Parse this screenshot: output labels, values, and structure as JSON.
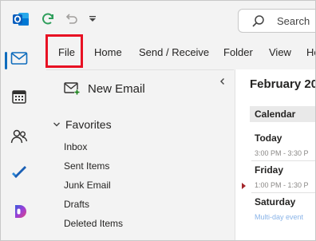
{
  "app": {
    "name": "Outlook"
  },
  "titlebar": {
    "search_label": "Search"
  },
  "ribbon": {
    "tabs": [
      {
        "label": "File",
        "highlighted": true
      },
      {
        "label": "Home"
      },
      {
        "label": "Send / Receive"
      },
      {
        "label": "Folder"
      },
      {
        "label": "View"
      },
      {
        "label": "He"
      }
    ]
  },
  "rail": {
    "items": [
      "mail",
      "calendar",
      "people",
      "to-do",
      "copilot"
    ],
    "active": "mail"
  },
  "folder_pane": {
    "new_email_label": "New Email",
    "favorites_label": "Favorites",
    "folders": [
      "Inbox",
      "Sent Items",
      "Junk Email",
      "Drafts",
      "Deleted Items"
    ]
  },
  "calendar_peek": {
    "month": "February 20",
    "header": "Calendar",
    "days": [
      {
        "label": "Today",
        "time": "3:00 PM - 3:30 P"
      },
      {
        "label": "Friday",
        "time": "1:00 PM - 1:30 P"
      },
      {
        "label": "Saturday",
        "note": "Multi-day event"
      }
    ]
  },
  "colors": {
    "accent": "#0f6cbd",
    "highlight_border": "#e81123",
    "background": "#f3f3f3",
    "marker": "#a4262c"
  }
}
